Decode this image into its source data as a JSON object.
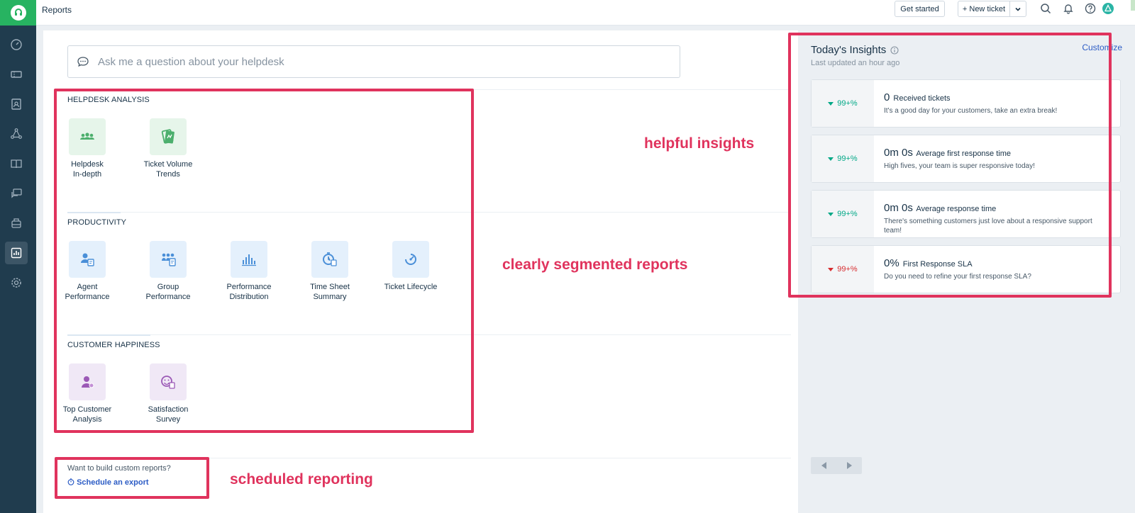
{
  "topbar": {
    "title": "Reports",
    "get_started": "Get started",
    "new_ticket": "+ New ticket"
  },
  "sidebar": {
    "items": [
      {
        "icon": "dashboard-icon"
      },
      {
        "icon": "tickets-icon"
      },
      {
        "icon": "contacts-icon"
      },
      {
        "icon": "social-icon"
      },
      {
        "icon": "solutions-icon"
      },
      {
        "icon": "forums-icon"
      },
      {
        "icon": "bot-icon"
      },
      {
        "icon": "reports-icon",
        "active": true
      },
      {
        "icon": "admin-settings-icon"
      }
    ]
  },
  "main": {
    "search_placeholder": "Ask me a question about your helpdesk",
    "sections": [
      {
        "title": "HELPDESK ANALYSIS",
        "reports": [
          {
            "line1": "Helpdesk",
            "line2": "In-depth"
          },
          {
            "line1": "Ticket Volume",
            "line2": "Trends"
          }
        ]
      },
      {
        "title": "PRODUCTIVITY",
        "reports": [
          {
            "line1": "Agent",
            "line2": "Performance"
          },
          {
            "line1": "Group",
            "line2": "Performance"
          },
          {
            "line1": "Performance",
            "line2": "Distribution"
          },
          {
            "line1": "Time Sheet",
            "line2": "Summary"
          },
          {
            "line1": "Ticket Lifecycle",
            "line2": ""
          }
        ]
      },
      {
        "title": "CUSTOMER HAPPINESS",
        "reports": [
          {
            "line1": "Top Customer",
            "line2": "Analysis"
          },
          {
            "line1": "Satisfaction",
            "line2": "Survey"
          }
        ]
      }
    ],
    "custom_question": "Want to build custom reports?",
    "schedule_link": "Schedule an export"
  },
  "annotations": {
    "insights": "helpful insights",
    "segmented": "clearly segmented reports",
    "scheduled": "scheduled reporting",
    "color": "#e0335d"
  },
  "insights": {
    "title": "Today's Insights",
    "subtitle": "Last updated an hour ago",
    "customize": "Customize",
    "cards": [
      {
        "delta": "99+%",
        "trend": "down",
        "value": "0",
        "label": "Received tickets",
        "desc": "It's a good day for your customers, take an extra break!"
      },
      {
        "delta": "99+%",
        "trend": "down",
        "value": "0m 0s",
        "label": "Average first response time",
        "desc": "High fives, your team is super responsive today!"
      },
      {
        "delta": "99+%",
        "trend": "down",
        "value": "0m 0s",
        "label": "Average response time",
        "desc": "There's something customers just love about a responsive support team!"
      },
      {
        "delta": "99+%",
        "trend": "down-bad",
        "value": "0%",
        "label": "First Response SLA",
        "desc": "Do you need to refine your first response SLA?"
      }
    ]
  }
}
